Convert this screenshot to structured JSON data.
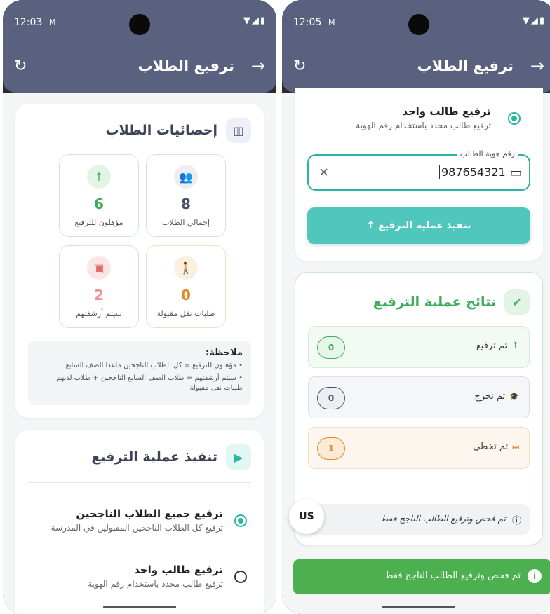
{
  "left_screen": {
    "status_time": "12:03",
    "mail_icon": "M",
    "status_icons": "▼◢▮",
    "appbar": {
      "title": "ترفيع الطلاب",
      "back_arrow": "→",
      "refresh": "↻"
    },
    "stats_card": {
      "title": "إحصائيات الطلاب",
      "tiles": [
        {
          "value": "8",
          "label": "إجمالي الطلاب",
          "icon": "group-icon",
          "glyph": "👥"
        },
        {
          "value": "6",
          "label": "مؤهلون للترفيع",
          "icon": "arrow-up-icon",
          "glyph": "↑"
        },
        {
          "value": "0",
          "label": "طلبات نقل مقبولة",
          "icon": "transfer-icon",
          "glyph": "🚶"
        },
        {
          "value": "2",
          "label": "سيتم أرشفتهم",
          "icon": "archive-icon",
          "glyph": "▣"
        }
      ],
      "note_title": "ملاحظة:",
      "note_lines": [
        "• مؤهلون للترفيع = كل الطلاب الناجحين ماعدا الصف السابع",
        "• سيتم أرشفتهم = طلاب الصف السابع الناجحين + طلاب لديهم طلبات نقل مقبولة"
      ]
    },
    "execute_card": {
      "title": "تنفيذ عملية الترفيع",
      "options": [
        {
          "title": "ترفيع جميع الطلاب الناجحين",
          "desc": "ترفيع كل الطلاب الناجحين المقبولين في المدرسة",
          "selected": true
        },
        {
          "title": "ترفيع طالب واحد",
          "desc": "ترفيع طالب محدد باستخدام رقم الهوية",
          "selected": false
        }
      ]
    }
  },
  "right_screen": {
    "status_time": "12:05",
    "mail_icon": "M",
    "status_icons": "▼◢▮",
    "appbar": {
      "title": "ترفيع الطلاب",
      "back_arrow": "→",
      "refresh": "↻"
    },
    "single_option": {
      "title": "ترفيع طالب واحد",
      "desc": "ترفيع طالب محدد باستخدام رقم الهوية",
      "selected": true
    },
    "id_field": {
      "label": "رقم هوية الطالب",
      "value": "987654321",
      "clear": "×"
    },
    "execute_button": {
      "label": "↑  تنفيذ عملية الترفيع"
    },
    "results_card": {
      "title": "نتائج عملية الترفيع",
      "rows": [
        {
          "label": "تم ترفيع",
          "icon": "arrow-up-icon",
          "glyph": "↑",
          "count": "0",
          "color": "#3fae5a",
          "bg": "#f3faf4"
        },
        {
          "label": "تم تخرج",
          "icon": "graduation-cap-icon",
          "glyph": "🎓",
          "count": "0",
          "color": "#4b5268",
          "bg": "#f5f6f8"
        },
        {
          "label": "تم تخطي",
          "icon": "skip-icon",
          "glyph": "⏭",
          "count": "1",
          "color": "#e08a2c",
          "bg": "#fdf6ee"
        }
      ],
      "info_text": "تم فحص وترفيع الطالب الناجح فقط"
    },
    "language_badge": "US",
    "snackbar": {
      "text": "تم فحص وترفيع الطالب الناجح فقط",
      "icon": "i"
    }
  },
  "colors": {
    "appbar": "#5a617f",
    "accent": "#2bb3a3",
    "button": "#4fc7bc",
    "success": "#4caf50"
  }
}
